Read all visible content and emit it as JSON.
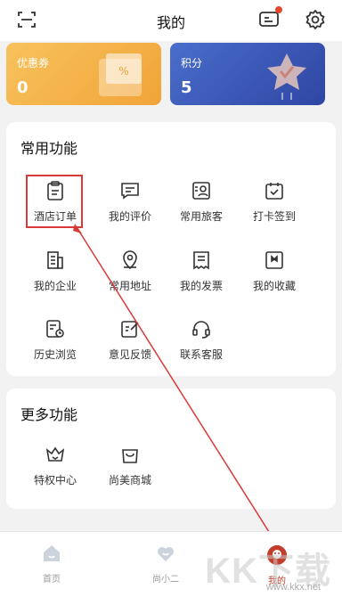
{
  "header": {
    "title": "我的"
  },
  "cards": {
    "coupon": {
      "label": "优惠券",
      "value": "0"
    },
    "points": {
      "label": "积分",
      "value": "5"
    }
  },
  "common": {
    "title": "常用功能",
    "items": [
      {
        "label": "酒店订单",
        "icon": "clipboard-icon"
      },
      {
        "label": "我的评价",
        "icon": "comment-icon"
      },
      {
        "label": "常用旅客",
        "icon": "contact-card-icon"
      },
      {
        "label": "打卡签到",
        "icon": "checkin-icon"
      },
      {
        "label": "我的企业",
        "icon": "building-icon"
      },
      {
        "label": "常用地址",
        "icon": "location-pin-icon"
      },
      {
        "label": "我的发票",
        "icon": "receipt-icon"
      },
      {
        "label": "我的收藏",
        "icon": "bookmark-icon"
      },
      {
        "label": "历史浏览",
        "icon": "history-icon"
      },
      {
        "label": "意见反馈",
        "icon": "feedback-icon"
      },
      {
        "label": "联系客服",
        "icon": "headset-icon"
      }
    ]
  },
  "more": {
    "title": "更多功能",
    "items": [
      {
        "label": "特权中心",
        "icon": "crown-icon"
      },
      {
        "label": "尚美商城",
        "icon": "shopping-bag-icon"
      }
    ]
  },
  "tabbar": {
    "items": [
      {
        "label": "首页",
        "icon": "home-icon"
      },
      {
        "label": "尚小二",
        "icon": "heart-icon"
      },
      {
        "label": "我的",
        "icon": "profile-avatar-icon",
        "active": true
      }
    ]
  },
  "watermark": {
    "text": "KK下载",
    "url": "www.kkx.net"
  },
  "colors": {
    "accent": "#c23e2b",
    "annotation": "#d83a3a",
    "coupon": "#f4b24a",
    "points": "#3a57b8"
  }
}
